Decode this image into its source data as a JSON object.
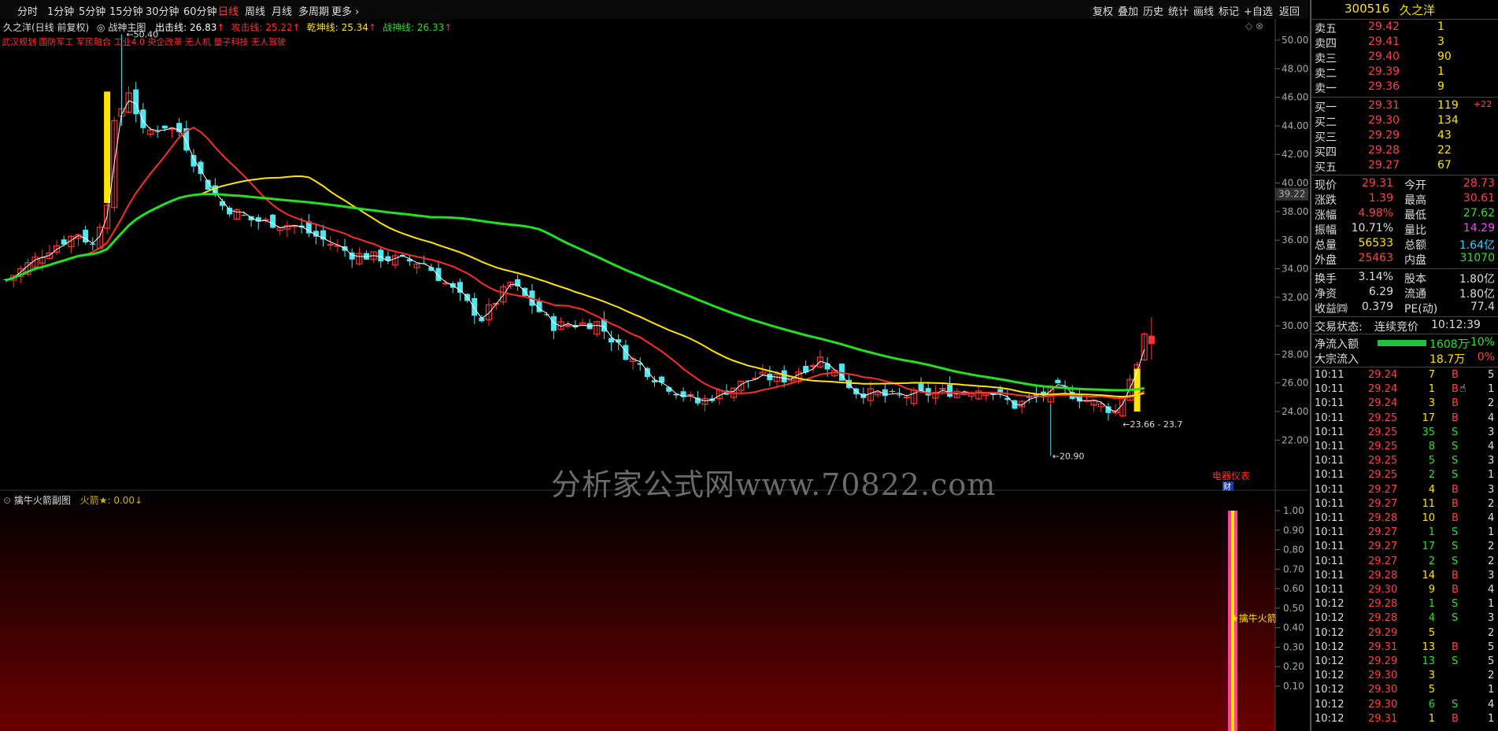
{
  "toolbar": {
    "periods": [
      "分时",
      "1分钟",
      "5分钟",
      "15分钟",
      "30分钟",
      "60分钟",
      "日线",
      "周线",
      "月线",
      "多周期",
      "更多"
    ],
    "active": "日线",
    "right": [
      "复权",
      "叠加",
      "历史",
      "统计",
      "画线",
      "标记",
      "+自选",
      "返回"
    ]
  },
  "main_chart": {
    "title": "久之洋(日线 前复权)",
    "indicator": "战神主图",
    "lines": [
      {
        "label": "出击线: 26.83",
        "color": "#ffffff"
      },
      {
        "label": "攻击线: 25.22",
        "color": "#ff2a2a"
      },
      {
        "label": "乾坤线: 25.34",
        "color": "#ffe400"
      },
      {
        "label": "战神线: 26.33",
        "color": "#22e022"
      }
    ],
    "concepts": "武汉规划 国防军工 军民融合 工业4.0 央企改革 无人机 量子科技 无人驾驶",
    "high_label": "50.40",
    "low_label": "20.90",
    "range_label": "23.66 - 23.7",
    "crosshair_price": "39.22",
    "side_note": "电器仪表",
    "fin_badge": "财",
    "y_ticks": [
      "50.00",
      "48.00",
      "46.00",
      "44.00",
      "42.00",
      "40.00",
      "38.00",
      "36.00",
      "34.00",
      "32.00",
      "30.00",
      "28.00",
      "26.00",
      "24.00",
      "22.00"
    ]
  },
  "sub_chart": {
    "title": "擒牛火箭副图",
    "value_label": "火箭★: 0.00",
    "marker": "★擒牛火箭",
    "y_ticks": [
      "1.00",
      "0.90",
      "0.80",
      "0.70",
      "0.60",
      "0.50",
      "0.40",
      "0.30",
      "0.20",
      "0.10"
    ]
  },
  "watermark": "分析家公式网www.70822.com",
  "quote": {
    "code": "300516",
    "name": "久之洋",
    "asks": [
      {
        "label": "卖五",
        "price": "29.42",
        "vol": "1"
      },
      {
        "label": "卖四",
        "price": "29.41",
        "vol": "3"
      },
      {
        "label": "卖三",
        "price": "29.40",
        "vol": "90"
      },
      {
        "label": "卖二",
        "price": "29.39",
        "vol": "1"
      },
      {
        "label": "卖一",
        "price": "29.36",
        "vol": "9"
      }
    ],
    "bids": [
      {
        "label": "买一",
        "price": "29.31",
        "vol": "119",
        "extra": "+22"
      },
      {
        "label": "买二",
        "price": "29.30",
        "vol": "134",
        "extra": ""
      },
      {
        "label": "买三",
        "price": "29.29",
        "vol": "43",
        "extra": ""
      },
      {
        "label": "买四",
        "price": "29.28",
        "vol": "22",
        "extra": ""
      },
      {
        "label": "买五",
        "price": "29.27",
        "vol": "67",
        "extra": ""
      }
    ],
    "stats": [
      {
        "l1": "现价",
        "v1": "29.31",
        "c1": "#ff4040",
        "l2": "今开",
        "v2": "28.73",
        "c2": "#ff4040"
      },
      {
        "l1": "涨跌",
        "v1": "1.39",
        "c1": "#ff4040",
        "l2": "最高",
        "v2": "30.61",
        "c2": "#ff4040"
      },
      {
        "l1": "涨幅",
        "v1": "4.98%",
        "c1": "#ff4040",
        "l2": "最低",
        "v2": "27.62",
        "c2": "#2ee02e"
      },
      {
        "l1": "振幅",
        "v1": "10.71%",
        "c1": "#dddddd",
        "l2": "量比",
        "v2": "14.29",
        "c2": "#ff40ff"
      },
      {
        "l1": "总量",
        "v1": "56533",
        "c1": "#ffe400",
        "l2": "总额",
        "v2": "1.64亿",
        "c2": "#3cd2ff"
      },
      {
        "l1": "外盘",
        "v1": "25463",
        "c1": "#ff4040",
        "l2": "内盘",
        "v2": "31070",
        "c2": "#2ee02e"
      }
    ],
    "stats2": [
      {
        "l1": "换手",
        "v1": "3.14%",
        "l2": "股本",
        "v2": "1.80亿"
      },
      {
        "l1": "净资",
        "v1": "6.29",
        "l2": "流通",
        "v2": "1.80亿"
      },
      {
        "l1": "收益㈣",
        "v1": "0.379",
        "l2": "PE(动)",
        "v2": "77.4"
      }
    ],
    "status_label": "交易状态:",
    "status_value": "连续竞价",
    "status_time": "10:12:39",
    "flows": [
      {
        "label": "净流入额",
        "value": "1608万",
        "pct": "-10%",
        "fill": 1.0
      },
      {
        "label": "大宗流入",
        "value": "18.7万",
        "pct": "0%",
        "fill": 0.0
      }
    ]
  },
  "ticks": [
    {
      "t": "10:11",
      "p": "29.24",
      "v": "7",
      "s": "B",
      "n": "5"
    },
    {
      "t": "10:11",
      "p": "29.24",
      "v": "1",
      "s": "B",
      "n": "1"
    },
    {
      "t": "10:11",
      "p": "29.24",
      "v": "3",
      "s": "B",
      "n": "2"
    },
    {
      "t": "10:11",
      "p": "29.25",
      "v": "17",
      "s": "B",
      "n": "4"
    },
    {
      "t": "10:11",
      "p": "29.25",
      "v": "35",
      "s": "S",
      "n": "3"
    },
    {
      "t": "10:11",
      "p": "29.25",
      "v": "8",
      "s": "S",
      "n": "4"
    },
    {
      "t": "10:11",
      "p": "29.25",
      "v": "5",
      "s": "S",
      "n": "3"
    },
    {
      "t": "10:11",
      "p": "29.25",
      "v": "2",
      "s": "S",
      "n": "1"
    },
    {
      "t": "10:11",
      "p": "29.27",
      "v": "4",
      "s": "B",
      "n": "3"
    },
    {
      "t": "10:11",
      "p": "29.27",
      "v": "11",
      "s": "B",
      "n": "2"
    },
    {
      "t": "10:11",
      "p": "29.28",
      "v": "10",
      "s": "B",
      "n": "4"
    },
    {
      "t": "10:11",
      "p": "29.27",
      "v": "1",
      "s": "S",
      "n": "1"
    },
    {
      "t": "10:11",
      "p": "29.27",
      "v": "17",
      "s": "S",
      "n": "2"
    },
    {
      "t": "10:11",
      "p": "29.27",
      "v": "2",
      "s": "S",
      "n": "2"
    },
    {
      "t": "10:11",
      "p": "29.28",
      "v": "14",
      "s": "B",
      "n": "3"
    },
    {
      "t": "10:11",
      "p": "29.30",
      "v": "9",
      "s": "B",
      "n": "4"
    },
    {
      "t": "10:12",
      "p": "29.28",
      "v": "1",
      "s": "S",
      "n": "1"
    },
    {
      "t": "10:12",
      "p": "29.28",
      "v": "4",
      "s": "S",
      "n": "3"
    },
    {
      "t": "10:12",
      "p": "29.29",
      "v": "5",
      "s": "",
      "n": "2"
    },
    {
      "t": "10:12",
      "p": "29.31",
      "v": "13",
      "s": "B",
      "n": "5"
    },
    {
      "t": "10:12",
      "p": "29.29",
      "v": "13",
      "s": "S",
      "n": "5"
    },
    {
      "t": "10:12",
      "p": "29.30",
      "v": "3",
      "s": "",
      "n": "2"
    },
    {
      "t": "10:12",
      "p": "29.30",
      "v": "5",
      "s": "",
      "n": "1"
    },
    {
      "t": "10:12",
      "p": "29.30",
      "v": "6",
      "s": "S",
      "n": "4"
    },
    {
      "t": "10:12",
      "p": "29.31",
      "v": "1",
      "s": "B",
      "n": "1"
    }
  ]
}
